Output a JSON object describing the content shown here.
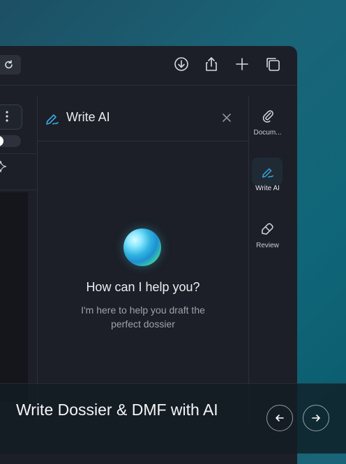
{
  "chat": {
    "title": "Write AI",
    "greeting": "How can I help you?",
    "subtitle": "I'm here to help you draft the perfect dossier"
  },
  "rail": {
    "items": [
      {
        "label": "Docum...",
        "icon": "paperclip-icon"
      },
      {
        "label": "Write AI",
        "icon": "pen-icon",
        "active": true
      },
      {
        "label": "Review",
        "icon": "review-icon"
      }
    ]
  },
  "toolbar": {
    "icons": [
      "reload-icon",
      "download-icon",
      "share-icon",
      "plus-icon",
      "copy-icon"
    ]
  },
  "overlay": {
    "title": "Write Dossier & DMF with AI",
    "prev": "previous",
    "next": "next"
  },
  "colors": {
    "accent": "#3aa7e0",
    "background": "#1c1f27"
  }
}
